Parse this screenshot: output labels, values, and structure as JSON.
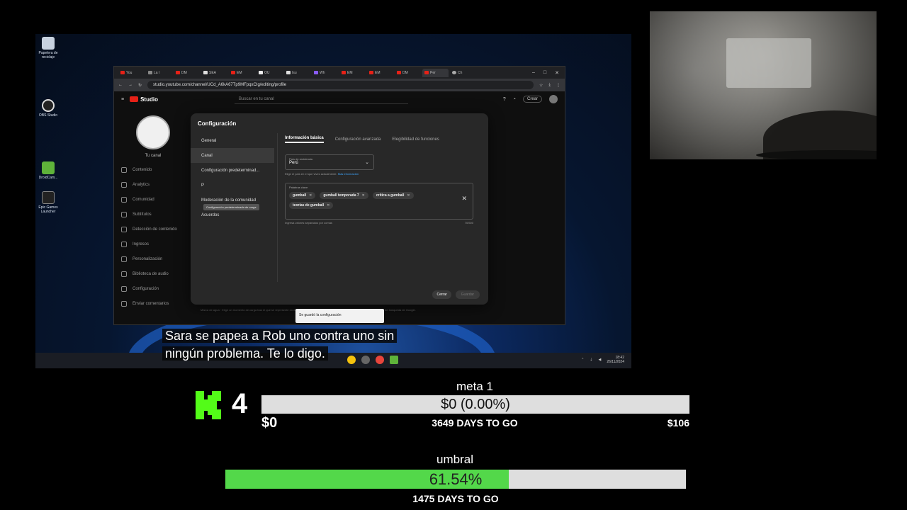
{
  "desktop": {
    "icons": [
      {
        "label": "Papelera de reciclaje",
        "icon": "recycle-bin-icon"
      },
      {
        "label": "OBS Studio",
        "icon": "obs-icon"
      },
      {
        "label": "DroidCam...",
        "icon": "droidcam-icon"
      },
      {
        "label": "Epic Games Launcher",
        "icon": "epic-icon"
      }
    ],
    "taskbar": {
      "time": "18:42",
      "date": "26/11/2024"
    }
  },
  "browser": {
    "tabs": [
      {
        "label": "You"
      },
      {
        "label": "La I"
      },
      {
        "label": "DM"
      },
      {
        "label": "SEA"
      },
      {
        "label": "EM"
      },
      {
        "label": "OU"
      },
      {
        "label": "Isu"
      },
      {
        "label": "Wh"
      },
      {
        "label": "EM"
      },
      {
        "label": "EM"
      },
      {
        "label": "DM"
      },
      {
        "label": "Per"
      },
      {
        "label": "Ch"
      }
    ],
    "url": "studio.youtube.com/channel/UCd_A6kA67Tp9MFpqxCIg/editing/profile",
    "studio_label": "Studio",
    "search_placeholder": "Buscar en tu canal",
    "create_label": "Crear"
  },
  "studio_sidebar": {
    "channel_label": "Tu canal",
    "items": [
      {
        "label": "Contenido"
      },
      {
        "label": "Analytics"
      },
      {
        "label": "Comunidad"
      },
      {
        "label": "Subtítulos"
      },
      {
        "label": "Detección de contenido"
      },
      {
        "label": "Ingresos"
      },
      {
        "label": "Personalización"
      },
      {
        "label": "Biblioteca de audio"
      },
      {
        "label": "Configuración"
      },
      {
        "label": "Enviar comentarios"
      }
    ]
  },
  "modal": {
    "title": "Configuración",
    "nav": [
      {
        "label": "General"
      },
      {
        "label": "Canal"
      },
      {
        "label": "Configuración predeterminad..."
      },
      {
        "label": "P"
      },
      {
        "label": "Moderación de la comunidad"
      },
      {
        "label": "Acuerdos"
      }
    ],
    "nav_tooltip": "Configuración predeterminada de carga",
    "tabs": [
      {
        "label": "Información básica"
      },
      {
        "label": "Configuración avanzada"
      },
      {
        "label": "Elegibilidad de funciones"
      }
    ],
    "country": {
      "label": "País de residencia",
      "value": "Perú"
    },
    "country_help": "Elige el país en el que vives actualmente.",
    "country_help_link": "Más información",
    "keywords": {
      "label": "Palabras clave",
      "chips": [
        "gumball",
        "gumball temporada 7",
        "crítica a gumball",
        "teorías de gumball"
      ],
      "help": "Ingresa valores separados por comas",
      "count": "70/500"
    },
    "cancel_label": "Cerrar",
    "save_label": "Guardar"
  },
  "toast": "Se guardó la configuración",
  "under_text": "Marca de agua · Elige un momento de carga tras el que se represente en el que el video aparece y se puede publicar en YouTube y en resultados de búsqueda de Google.",
  "subtitle": {
    "line1": "Sara se papea a Rob uno contra uno sin",
    "line2": "ningún problema. Te lo digo."
  },
  "kick": {
    "count": "4",
    "brand_color": "#53fc18"
  },
  "goals": [
    {
      "title": "meta 1",
      "amount_text": "$0 (0.00%)",
      "progress": 0.0,
      "start": "$0",
      "days_left": "3649 DAYS TO GO",
      "target": "$106"
    },
    {
      "title": "umbral",
      "percent_text": "61.54%",
      "progress": 0.6154,
      "days_left": "1475 DAYS TO GO"
    }
  ],
  "colors": {
    "bar_fill": "#53d84a",
    "bar_track": "#dedede",
    "youtube_red": "#e62117"
  }
}
